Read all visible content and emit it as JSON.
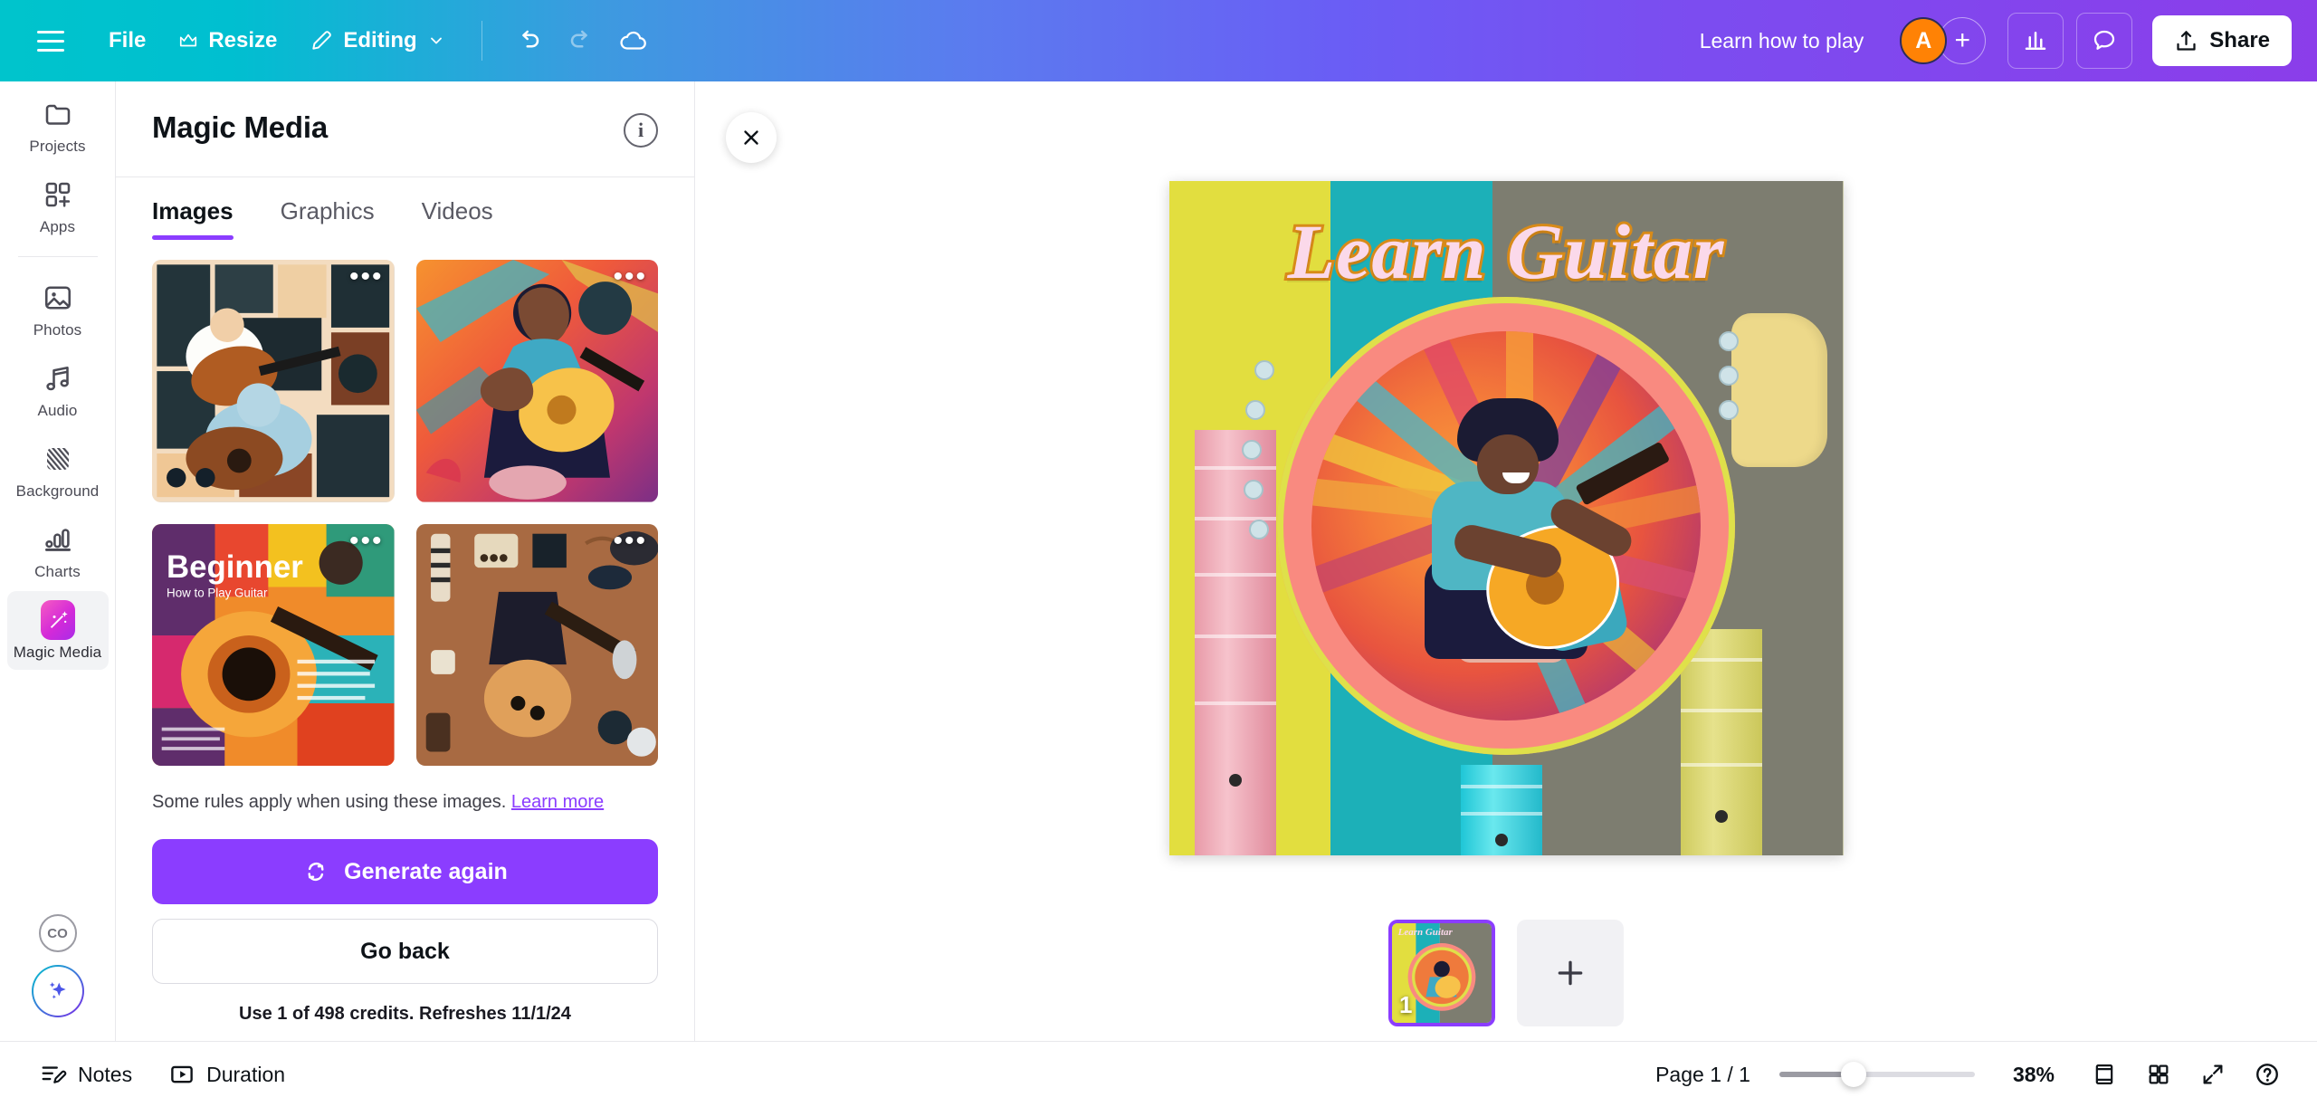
{
  "topbar": {
    "menu_icon": "hamburger-icon",
    "file_label": "File",
    "resize_label": "Resize",
    "resize_icon": "crown-icon",
    "editing_label": "Editing",
    "editing_icon": "pencil-icon",
    "chevron_icon": "chevron-down-icon",
    "undo_icon": "undo-icon",
    "redo_icon": "redo-icon",
    "cloud_icon": "cloud-saved-icon",
    "learn_label": "Learn how to play",
    "avatar_initial": "A",
    "avatar_add_icon": "plus-icon",
    "avatar_color": "#ff8205",
    "insights_icon": "bar-chart-icon",
    "comment_icon": "comment-icon",
    "share_label": "Share",
    "share_icon": "upload-icon"
  },
  "rail": {
    "items": [
      {
        "label": "Projects",
        "icon": "folder-icon",
        "active": false
      },
      {
        "label": "Apps",
        "icon": "apps-grid-plus-icon",
        "active": false
      },
      {
        "label": "Photos",
        "icon": "image-icon",
        "active": false
      },
      {
        "label": "Audio",
        "icon": "music-note-icon",
        "active": false
      },
      {
        "label": "Background",
        "icon": "hatch-pattern-icon",
        "active": false
      },
      {
        "label": "Charts",
        "icon": "bar-chart-icon",
        "active": false
      },
      {
        "label": "Magic Media",
        "icon": "magic-media-icon",
        "active": true
      }
    ],
    "bottom": {
      "copyright_icon": "copyright-circle-icon",
      "copyright_label": "CO",
      "ai_icon": "sparkle-icon"
    }
  },
  "panel": {
    "title": "Magic Media",
    "info_icon": "info-icon",
    "info_label": "i",
    "tabs": [
      {
        "label": "Images",
        "active": true
      },
      {
        "label": "Graphics",
        "active": false
      },
      {
        "label": "Videos",
        "active": false
      }
    ],
    "results": [
      {
        "alt": "Guitar lesson collage illustration",
        "dots_icon": "more-options-icon"
      },
      {
        "alt": "Colorful guitarist playing acoustic guitar",
        "dots_icon": "more-options-icon"
      },
      {
        "alt": "Beginner Guitar magazine cover",
        "dots_icon": "more-options-icon"
      },
      {
        "alt": "Electric guitar player flat lay illustration",
        "dots_icon": "more-options-icon"
      }
    ],
    "rules_text": "Some rules apply when using these images.",
    "learn_more_label": "Learn more",
    "generate_label": "Generate again",
    "generate_icon": "refresh-icon",
    "go_back_label": "Go back",
    "credits_text": "Use 1 of 498 credits. Refreshes 11/1/24",
    "accent_color": "#8b3dff"
  },
  "canvas": {
    "close_icon": "close-icon",
    "design": {
      "title": "Learn Guitar",
      "title_color": "#fbd9ea",
      "title_outline_color": "#d88a18",
      "bg_colors": [
        "#e2de3f",
        "#1cb0b8",
        "#7d7d70"
      ],
      "ring_color": "#f98a80",
      "ring_accent_color": "#dfe04a",
      "neck_colors": [
        "#f2a0b4",
        "#3fd0d8",
        "#d9d76a"
      ]
    },
    "pages": [
      {
        "number": "1",
        "selected": true
      }
    ],
    "add_page_icon": "plus-icon"
  },
  "bottombar": {
    "notes_label": "Notes",
    "notes_icon": "notes-icon",
    "duration_label": "Duration",
    "duration_icon": "duration-play-icon",
    "page_indicator": "Page 1 / 1",
    "zoom_value": "38%",
    "zoom_percent": 38,
    "fit_icon": "fit-page-icon",
    "grid_icon": "grid-view-icon",
    "expand_icon": "expand-icon",
    "help_icon": "help-icon"
  }
}
